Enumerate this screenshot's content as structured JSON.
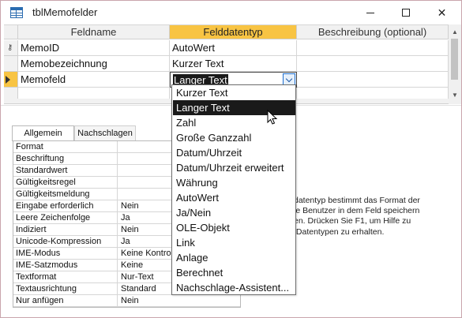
{
  "window": {
    "title": "tblMemofelder"
  },
  "grid": {
    "headers": {
      "name": "Feldname",
      "type": "Felddatentyp",
      "desc": "Beschreibung (optional)"
    },
    "rows": [
      {
        "name": "MemoID",
        "type": "AutoWert",
        "desc": ""
      },
      {
        "name": "Memobezeichnung",
        "type": "Kurzer Text",
        "desc": ""
      },
      {
        "name": "Memofeld",
        "type": "Langer Text",
        "desc": ""
      }
    ]
  },
  "dropdown": {
    "options": [
      "Kurzer Text",
      "Langer Text",
      "Zahl",
      "Große Ganzzahl",
      "Datum/Uhrzeit",
      "Datum/Uhrzeit erweitert",
      "Währung",
      "AutoWert",
      "Ja/Nein",
      "OLE-Objekt",
      "Link",
      "Anlage",
      "Berechnet",
      "Nachschlage-Assistent..."
    ],
    "selected": "Langer Text"
  },
  "tabs": {
    "general": "Allgemein",
    "lookup": "Nachschlagen"
  },
  "properties": [
    {
      "label": "Format",
      "value": ""
    },
    {
      "label": "Beschriftung",
      "value": ""
    },
    {
      "label": "Standardwert",
      "value": ""
    },
    {
      "label": "Gültigkeitsregel",
      "value": ""
    },
    {
      "label": "Gültigkeitsmeldung",
      "value": ""
    },
    {
      "label": "Eingabe erforderlich",
      "value": "Nein"
    },
    {
      "label": "Leere Zeichenfolge",
      "value": "Ja"
    },
    {
      "label": "Indiziert",
      "value": "Nein"
    },
    {
      "label": "Unicode-Kompression",
      "value": "Ja"
    },
    {
      "label": "IME-Modus",
      "value": "Keine Kontrolle"
    },
    {
      "label": "IME-Satzmodus",
      "value": "Keine"
    },
    {
      "label": "Textformat",
      "value": "Nur-Text"
    },
    {
      "label": "Textausrichtung",
      "value": "Standard"
    },
    {
      "label": "Nur anfügen",
      "value": "Nein"
    }
  ],
  "help": {
    "lines": [
      "datentyp bestimmt das Format der",
      "ie Benutzer in dem Feld speichern",
      "en. Drücken Sie F1, um Hilfe zu",
      " Datentypen zu erhalten."
    ]
  },
  "icons": {
    "key": "key-icon",
    "current": "row-selector-arrow-icon",
    "cursor": "mouse-pointer-icon"
  }
}
